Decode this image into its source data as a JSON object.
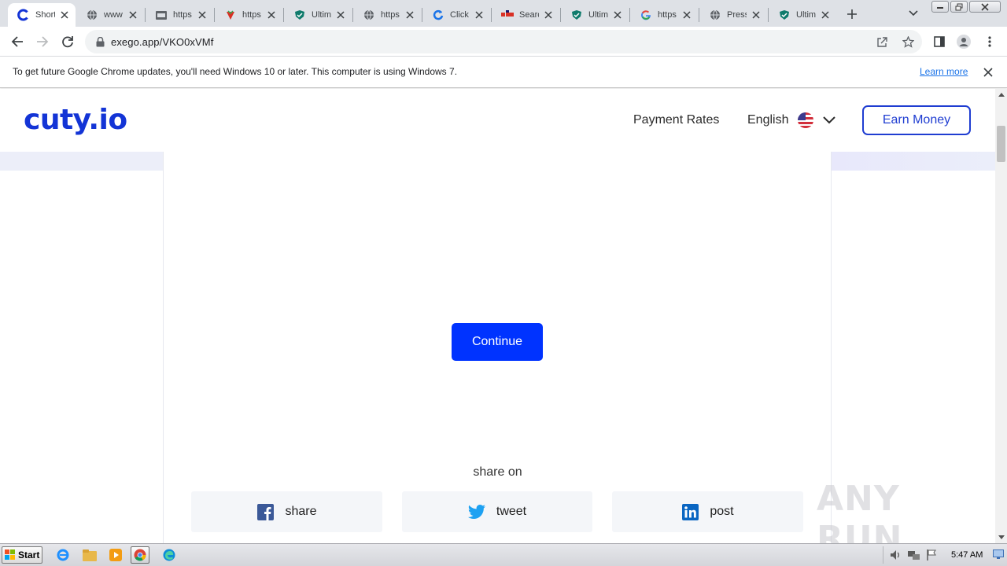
{
  "browser": {
    "tabs": [
      {
        "title": "Short",
        "icon": "cuty-icon",
        "active": true
      },
      {
        "title": "www",
        "icon": "globe-icon"
      },
      {
        "title": "https",
        "icon": "folder-icon"
      },
      {
        "title": "https",
        "icon": "strawberry-icon"
      },
      {
        "title": "Ultim",
        "icon": "shield-icon"
      },
      {
        "title": "https",
        "icon": "globe-icon"
      },
      {
        "title": "Click",
        "icon": "refresh-favicon"
      },
      {
        "title": "Searc",
        "icon": "squares-icon"
      },
      {
        "title": "Ultim",
        "icon": "shield-icon"
      },
      {
        "title": "https",
        "icon": "google-icon"
      },
      {
        "title": "Press",
        "icon": "globe-icon"
      },
      {
        "title": "Ultim",
        "icon": "shield-icon"
      }
    ],
    "url": "exego.app/VKO0xVMf"
  },
  "infobar": {
    "message": "To get future Google Chrome updates, you'll need Windows 10 or later. This computer is using Windows 7.",
    "learn_more": "Learn more"
  },
  "site": {
    "logo": "cuty.io",
    "nav": {
      "payment_rates": "Payment Rates",
      "language": "English",
      "earn_money": "Earn Money"
    },
    "continue_label": "Continue",
    "share_heading": "share on",
    "share_buttons": [
      {
        "label": "share",
        "icon": "facebook-icon"
      },
      {
        "label": "tweet",
        "icon": "twitter-icon"
      },
      {
        "label": "post",
        "icon": "linkedin-icon"
      }
    ],
    "watermark": "ANY RUN"
  },
  "taskbar": {
    "start_label": "Start",
    "clock": "5:47 AM"
  },
  "colors": {
    "brand": "#1334d6",
    "continue": "#0033ff",
    "facebook": "#3b5998",
    "twitter": "#1da1f2",
    "linkedin": "#0a66c2"
  }
}
